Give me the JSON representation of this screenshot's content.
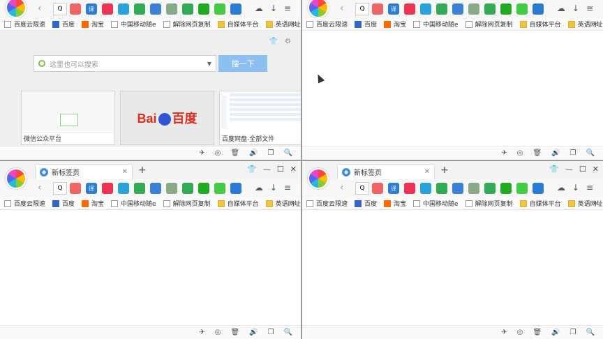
{
  "browser": {
    "tab_title": "新标签页",
    "new_tab": "+",
    "window_controls": [
      "👕",
      "—",
      "☐",
      "✕"
    ],
    "addr_icon": "Q",
    "toolbar_icons": [
      {
        "name": "app1",
        "color": "#e66"
      },
      {
        "name": "translate",
        "color": "#2d7fd3",
        "label": "译"
      },
      {
        "name": "calendar",
        "color": "#e35"
      },
      {
        "name": "bird",
        "color": "#29a3d9"
      },
      {
        "name": "shield",
        "color": "#3a5"
      },
      {
        "name": "download",
        "color": "#3b82d6"
      },
      {
        "name": "game",
        "color": "#8a8"
      },
      {
        "name": "check",
        "color": "#3a5"
      },
      {
        "name": "mask",
        "color": "#2a2"
      },
      {
        "name": "mushroom",
        "color": "#4c4"
      },
      {
        "name": "expand",
        "color": "#2b7bd6"
      }
    ],
    "nav_right": [
      "☁",
      "↓",
      "≡"
    ]
  },
  "bookmarks": [
    {
      "label": "百度云限速",
      "icon": "page"
    },
    {
      "label": "百度",
      "icon": "paw"
    },
    {
      "label": "淘宝",
      "icon": "tb"
    },
    {
      "label": "中国移动随e",
      "icon": "page"
    },
    {
      "label": "解除网页复制",
      "icon": "page"
    },
    {
      "label": "自媒体平台",
      "icon": "folder"
    },
    {
      "label": "英语网址",
      "icon": "folder"
    }
  ],
  "bookmark_more": "»",
  "newtab_page": {
    "search_placeholder": "这里也可以搜索",
    "search_button": "搜一下",
    "thumbnails": [
      {
        "label": "微信公众平台"
      },
      {
        "label": "",
        "logo_text_left": "Bai",
        "logo_text_mid": "du",
        "logo_text_right": "百度"
      },
      {
        "label": "百度网盘-全部文件"
      }
    ]
  },
  "status_icons": [
    "✈",
    "◎",
    "🗑",
    "🔊",
    "❐",
    "🔍"
  ]
}
